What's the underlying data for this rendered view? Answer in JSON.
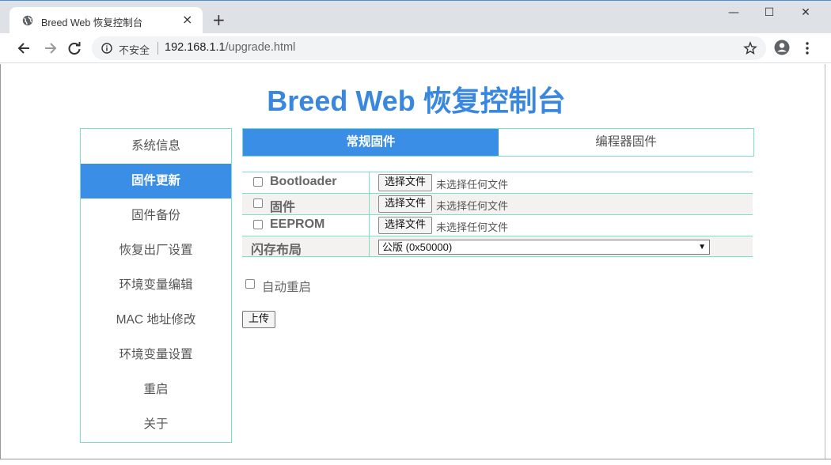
{
  "browser": {
    "tab_title": "Breed Web 恢复控制台",
    "tab_close": "×",
    "new_tab": "+",
    "window_controls": {
      "minimize": "—",
      "maximize": "☐",
      "close": "✕"
    },
    "insecure_label": "不安全",
    "url_host": "192.168.1.1",
    "url_path": "/upgrade.html"
  },
  "page": {
    "title": "Breed Web 恢复控制台"
  },
  "sidebar": {
    "items": [
      {
        "label": "系统信息",
        "active": false
      },
      {
        "label": "固件更新",
        "active": true
      },
      {
        "label": "固件备份",
        "active": false
      },
      {
        "label": "恢复出厂设置",
        "active": false
      },
      {
        "label": "环境变量编辑",
        "active": false
      },
      {
        "label": "MAC 地址修改",
        "active": false
      },
      {
        "label": "环境变量设置",
        "active": false
      },
      {
        "label": "重启",
        "active": false
      },
      {
        "label": "关于",
        "active": false
      }
    ]
  },
  "tabs": {
    "active": "常规固件",
    "inactive": "编程器固件"
  },
  "firmware": {
    "rows": [
      {
        "name": "Bootloader",
        "button": "选择文件",
        "hint": "未选择任何文件",
        "checked": false
      },
      {
        "name": "固件",
        "button": "选择文件",
        "hint": "未选择任何文件",
        "checked": false
      },
      {
        "name": "EEPROM",
        "button": "选择文件",
        "hint": "未选择任何文件",
        "checked": false
      }
    ],
    "layout_label": "闪存布局",
    "layout_value": "公版 (0x50000)"
  },
  "options": {
    "auto_reboot_label": "自动重启",
    "auto_reboot_checked": false
  },
  "actions": {
    "upload_label": "上传"
  },
  "colors": {
    "accent": "#3a8ee6",
    "title": "#3a87e0",
    "border": "#7ce0c8"
  },
  "icons": [
    "globe-icon",
    "back-arrow-icon",
    "forward-arrow-icon",
    "reload-icon",
    "info-icon",
    "star-icon",
    "profile-icon",
    "more-icon"
  ]
}
